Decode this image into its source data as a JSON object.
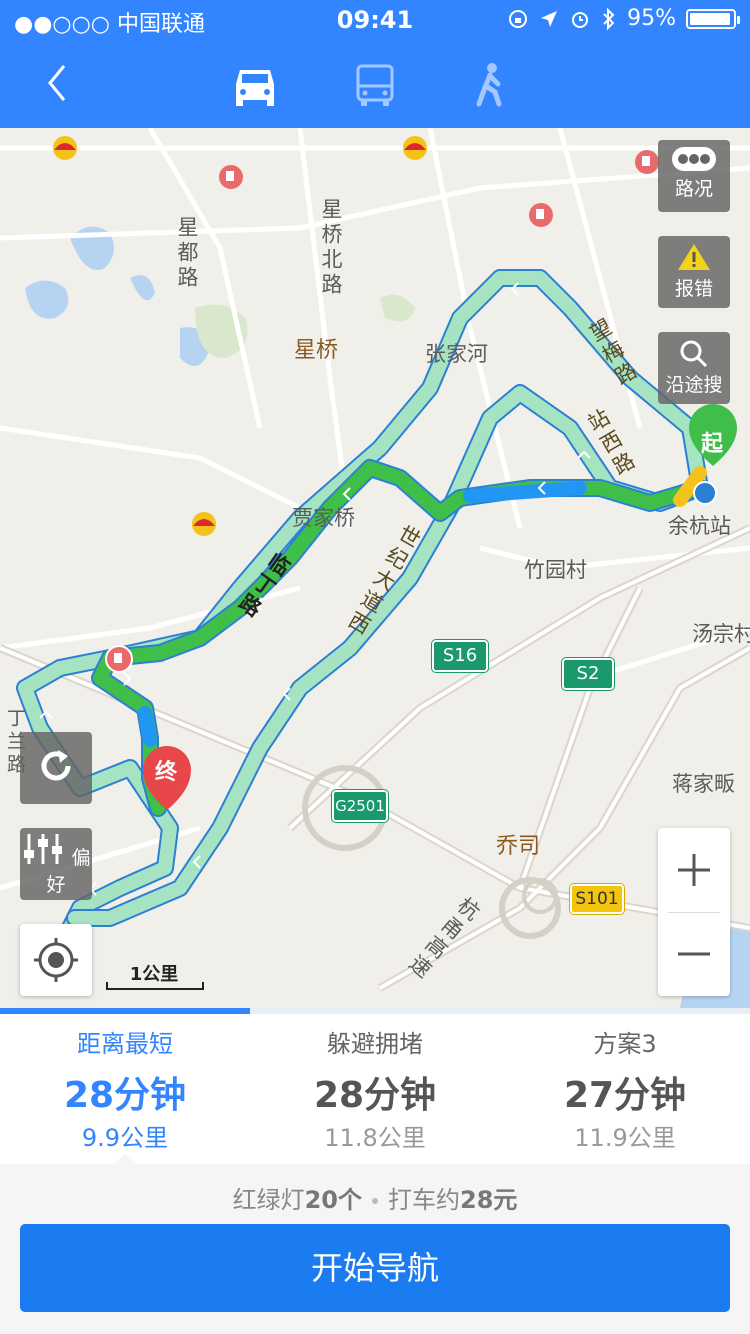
{
  "status_bar": {
    "carrier": "●●○○○ 中国联通",
    "time": "09:41",
    "battery": "95%",
    "battery_level": 0.95
  },
  "nav": {
    "modes": [
      {
        "name": "car-mode",
        "icon": "car-icon",
        "selected": true
      },
      {
        "name": "bus-mode",
        "icon": "bus-icon",
        "selected": false
      },
      {
        "name": "walk-mode",
        "icon": "walk-icon",
        "selected": false
      }
    ]
  },
  "map": {
    "labels": {
      "xingdu_road": "星都路",
      "xingqiao_north_road": "星桥北路",
      "xingqiao": "星桥",
      "zhangjiahe": "张家河",
      "wangmei_road": "望梅路",
      "zhanxi_road": "站西路",
      "yuhang_station": "余杭站",
      "jiajiaqiao": "贾家桥",
      "linding_road": "临丁路",
      "shiji_avenue": "世纪大道西",
      "zhuyuancun": "竹园村",
      "tangzongcun": "汤宗村",
      "jiangjiafan": "蒋家畈",
      "qiaosi": "乔司",
      "hangyong_expressway": "杭甬高速",
      "dinglan_road": "丁兰路"
    },
    "shields": {
      "s16": "S16",
      "s2": "S2",
      "g2501": "G2501",
      "s101": "S101"
    },
    "markers": {
      "start": "起",
      "end": "终"
    },
    "scale": "1公里",
    "tools": {
      "traffic": "路况",
      "report": "报错",
      "search_along": "沿途搜",
      "preference": "偏好"
    }
  },
  "plans": [
    {
      "name": "距离最短",
      "duration": "28分钟",
      "distance": "9.9公里",
      "active": true
    },
    {
      "name": "躲避拥堵",
      "duration": "28分钟",
      "distance": "11.8公里",
      "active": false
    },
    {
      "name": "方案3",
      "duration": "27分钟",
      "distance": "11.9公里",
      "active": false
    }
  ],
  "info": {
    "lights_prefix": "红绿灯",
    "lights_count": "20个",
    "taxi_prefix": "打车约",
    "taxi_price": "28元"
  },
  "start_button": "开始导航",
  "colors": {
    "brand": "#3385ff",
    "route_green": "#3fbf4a",
    "route_light": "#a6e3c2",
    "route_blue": "#2196f3"
  }
}
